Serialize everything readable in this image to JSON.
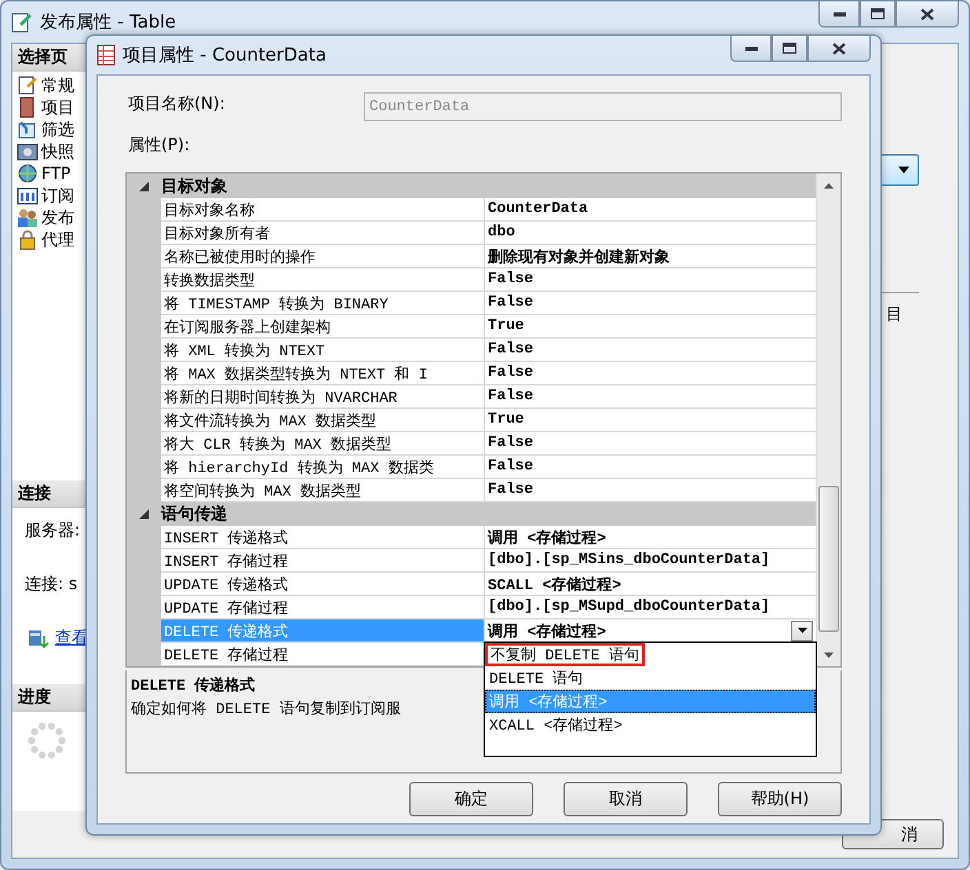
{
  "background_window": {
    "title": "发布属性 - Table",
    "sidebar": {
      "header": "选择页",
      "items": [
        "常规",
        "项目",
        "筛选",
        "快照",
        "FTP",
        "订阅",
        "发布",
        "代理"
      ]
    },
    "connection": {
      "header": "连接",
      "server_label": "服务器:",
      "connection_label": "连接: s",
      "link": "查看"
    },
    "progress": {
      "header": "进度"
    },
    "side_label": "目",
    "buttons": [
      "消"
    ]
  },
  "dialog": {
    "title": "项目属性 - CounterData",
    "name_label": "项目名称(N):",
    "name_value": "CounterData",
    "properties_label": "属性(P):",
    "categories": [
      {
        "name": "目标对象",
        "expanded": true,
        "rows": [
          {
            "name": "目标对象名称",
            "value": "CounterData",
            "selected": false
          },
          {
            "name": "目标对象所有者",
            "value": "dbo",
            "selected": false
          },
          {
            "name": "名称已被使用时的操作",
            "value": "删除现有对象并创建新对象",
            "selected": false
          },
          {
            "name": "转换数据类型",
            "value": "False",
            "selected": false
          },
          {
            "name": "将 TIMESTAMP 转换为 BINARY",
            "value": "False",
            "selected": false
          },
          {
            "name": "在订阅服务器上创建架构",
            "value": "True",
            "selected": false
          },
          {
            "name": "将 XML 转换为 NTEXT",
            "value": "False",
            "selected": false
          },
          {
            "name": "将 MAX 数据类型转换为 NTEXT 和 I",
            "value": "False",
            "selected": false
          },
          {
            "name": "将新的日期时间转换为 NVARCHAR",
            "value": "False",
            "selected": false
          },
          {
            "name": "将文件流转换为 MAX 数据类型",
            "value": "True",
            "selected": false
          },
          {
            "name": "将大 CLR 转换为 MAX 数据类型",
            "value": "False",
            "selected": false
          },
          {
            "name": "将 hierarchyId 转换为 MAX 数据类",
            "value": "False",
            "selected": false
          },
          {
            "name": "将空间转换为 MAX 数据类型",
            "value": "False",
            "selected": false
          }
        ]
      },
      {
        "name": "语句传递",
        "expanded": true,
        "rows": [
          {
            "name": "INSERT 传递格式",
            "value": "调用 <存储过程>",
            "selected": false
          },
          {
            "name": "INSERT 存储过程",
            "value": "[dbo].[sp_MSins_dboCounterData]",
            "selected": false
          },
          {
            "name": "UPDATE 传递格式",
            "value": "SCALL <存储过程>",
            "selected": false
          },
          {
            "name": "UPDATE 存储过程",
            "value": "[dbo].[sp_MSupd_dboCounterData]",
            "selected": false
          },
          {
            "name": "DELETE 传递格式",
            "value": "调用 <存储过程>",
            "selected": true,
            "options": [
              {
                "label": "不复制 DELETE 语句",
                "selected": false,
                "highlighted": true
              },
              {
                "label": "DELETE 语句",
                "selected": false,
                "highlighted": false
              },
              {
                "label": "调用 <存储过程>",
                "selected": true,
                "highlighted": false
              },
              {
                "label": "XCALL <存储过程>",
                "selected": false,
                "highlighted": false
              }
            ]
          },
          {
            "name": "DELETE 存储过程",
            "value": "",
            "selected": false
          }
        ]
      }
    ],
    "description": {
      "title": "DELETE 传递格式",
      "text": "确定如何将 DELETE 语句复制到订阅服"
    },
    "buttons": [
      "确定",
      "取消",
      "帮助(H)"
    ]
  }
}
